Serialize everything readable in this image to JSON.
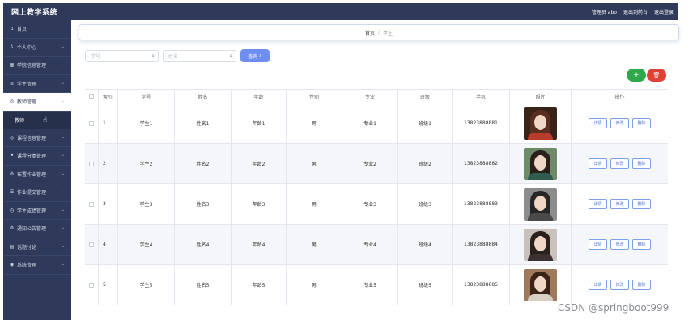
{
  "header": {
    "title": "网上教学系统",
    "admin": "管理员 abo",
    "to_frontend": "退出到前台",
    "logout": "退出登录"
  },
  "sidebar": {
    "items": [
      {
        "label": "首页",
        "icon": "home-icon",
        "glyph": "⌂"
      },
      {
        "label": "个人中心",
        "icon": "user-icon",
        "glyph": "♙"
      },
      {
        "label": "学院信息管理",
        "icon": "building-icon",
        "glyph": "▦"
      },
      {
        "label": "学生管理",
        "icon": "list-icon",
        "glyph": "≡"
      },
      {
        "label": "教师管理",
        "icon": "teacher-icon",
        "glyph": "◎",
        "active": true
      },
      {
        "label": "课程信息管理",
        "icon": "course-icon",
        "glyph": "◎"
      },
      {
        "label": "课程分类管理",
        "icon": "flag-icon",
        "glyph": "⚑"
      },
      {
        "label": "布置作业管理",
        "icon": "gear-icon",
        "glyph": "⚙"
      },
      {
        "label": "作业提交管理",
        "icon": "sliders-icon",
        "glyph": "☰"
      },
      {
        "label": "学生成绩管理",
        "icon": "clock-icon",
        "glyph": "◷"
      },
      {
        "label": "通知公告管理",
        "icon": "gear-icon",
        "glyph": "⚙"
      },
      {
        "label": "话题讨论",
        "icon": "chat-icon",
        "glyph": "▤"
      },
      {
        "label": "系统管理",
        "icon": "location-icon",
        "glyph": "◉"
      }
    ],
    "submenu_label": "教师"
  },
  "breadcrumb": {
    "home": "首页",
    "separator": "/",
    "current": "学生"
  },
  "search": {
    "field1_placeholder": "学号",
    "field2_placeholder": "姓名",
    "query_label": "查询"
  },
  "actions": {
    "add_glyph": "+",
    "delete_glyph": "🗑"
  },
  "table": {
    "headers": {
      "index": "索引",
      "xh": "学号",
      "xm": "姓名",
      "nj": "年龄",
      "xb": "性别",
      "zy": "专业",
      "bj": "班级",
      "sj": "手机",
      "zp": "照片",
      "op": "操作"
    },
    "op_labels": {
      "detail": "详情",
      "edit": "修改",
      "delete": "删除"
    },
    "rows": [
      {
        "index": "1",
        "xh": "学生1",
        "xm": "姓名1",
        "nj": "年龄1",
        "xb": "男",
        "zy": "专业1",
        "bj": "班级1",
        "sj": "13823888881",
        "photo": {
          "bg": "#3a2418",
          "hair": "#5a2e20",
          "shoulder": "#b83b2c"
        }
      },
      {
        "index": "2",
        "xh": "学生2",
        "xm": "姓名2",
        "nj": "年龄2",
        "xb": "男",
        "zy": "专业2",
        "bj": "班级2",
        "sj": "13823888882",
        "photo": {
          "bg": "#6f8a6a",
          "hair": "#2b1f1a",
          "shoulder": "#2f5e4f"
        }
      },
      {
        "index": "3",
        "xh": "学生3",
        "xm": "姓名3",
        "nj": "年龄3",
        "xb": "男",
        "zy": "专业3",
        "bj": "班级3",
        "sj": "13823888883",
        "photo": {
          "bg": "#8c8c8c",
          "hair": "#262626",
          "shoulder": "#4a4a4a"
        }
      },
      {
        "index": "4",
        "xh": "学生4",
        "xm": "姓名4",
        "nj": "年龄4",
        "xb": "男",
        "zy": "专业4",
        "bj": "班级4",
        "sj": "13823888884",
        "photo": {
          "bg": "#c9c2bc",
          "hair": "#2a211d",
          "shoulder": "#3a3230"
        }
      },
      {
        "index": "5",
        "xh": "学生5",
        "xm": "姓名5",
        "nj": "年龄5",
        "xb": "男",
        "zy": "专业5",
        "bj": "班级5",
        "sj": "13823888885",
        "photo": {
          "bg": "#a07a5c",
          "hair": "#3a2416",
          "shoulder": "#d8cfc4"
        }
      }
    ]
  },
  "watermark": "CSDN @springboot999"
}
